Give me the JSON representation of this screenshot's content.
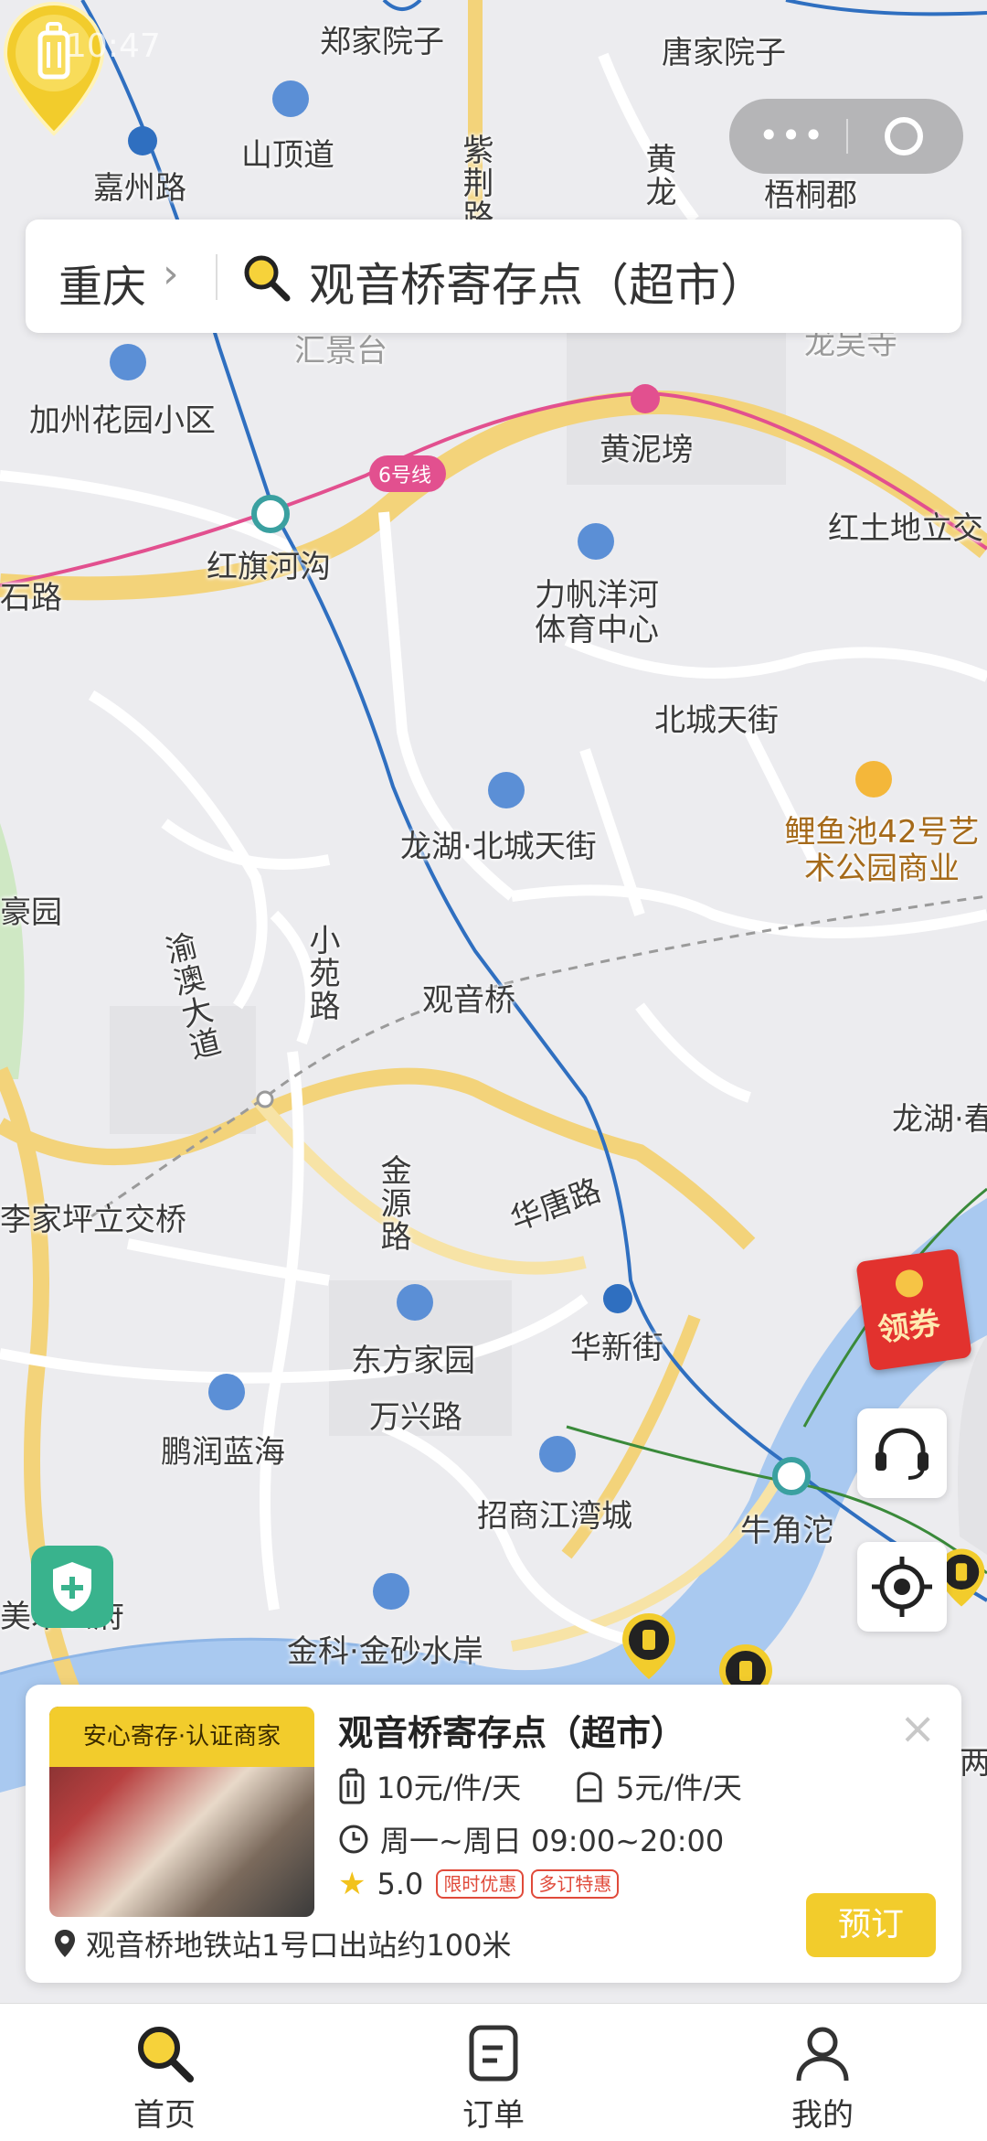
{
  "status_bar": {
    "time": "10:47"
  },
  "capsule": {
    "menu_icon": "more-dots-icon",
    "close_icon": "target-ring-icon"
  },
  "search": {
    "city": "重庆",
    "query": "观音桥寄存点（超市）"
  },
  "map_labels": {
    "l1": "郑家院子",
    "l2": "唐家院子",
    "l3": "山顶道",
    "l4": "嘉州路",
    "l5": "梧桐郡",
    "l6": "紫荆路",
    "l7": "黄龙",
    "l8": "汇景台",
    "l9": "加州花园小区",
    "l10": "黄泥塝",
    "l11": "6号线",
    "l12": "红旗河沟",
    "l13": "石路",
    "l14": "红土地立交",
    "l15": "力帆洋河体育中心",
    "l16": "北城天街",
    "l17": "鲤鱼池42号艺术公园商业",
    "l18": "龙湖·北城天街",
    "l19": "豪园",
    "l20": "渝澳大道",
    "l21": "小苑路",
    "l22": "观音桥",
    "l23": "龙湖·春",
    "l24": "李家坪立交桥",
    "l25": "金源路",
    "l26": "华唐路",
    "l27": "华新街",
    "l28": "东方家园",
    "l29": "万兴路",
    "l30": "鹏润蓝海",
    "l31": "招商江湾城",
    "l32": "牛角沱",
    "l33": "美术公府",
    "l34": "金科·金砂水岸",
    "l35": "龙吴寺",
    "l36": "两"
  },
  "coupon": {
    "label": "领券"
  },
  "store_card": {
    "badge": "安心寄存·认证商家",
    "title": "观音桥寄存点（超市）",
    "price_large": "10元/件/天",
    "price_small": "5元/件/天",
    "hours": "周一~周日 09:00~20:00",
    "rating": "5.0",
    "tag1": "限时优惠",
    "tag2": "多订特惠",
    "address": "观音桥地铁站1号口出站约100米",
    "book_label": "预订",
    "close_label": "×"
  },
  "tabbar": [
    {
      "label": "首页",
      "icon": "search-icon",
      "active": true
    },
    {
      "label": "订单",
      "icon": "order-icon",
      "active": false
    },
    {
      "label": "我的",
      "icon": "profile-icon",
      "active": false
    }
  ],
  "colors": {
    "accent": "#f2cc2c",
    "metro_pink": "#e2508f",
    "metro_blue": "#2f6fc0",
    "water": "#a9c9f0",
    "road": "#f3d37a"
  }
}
